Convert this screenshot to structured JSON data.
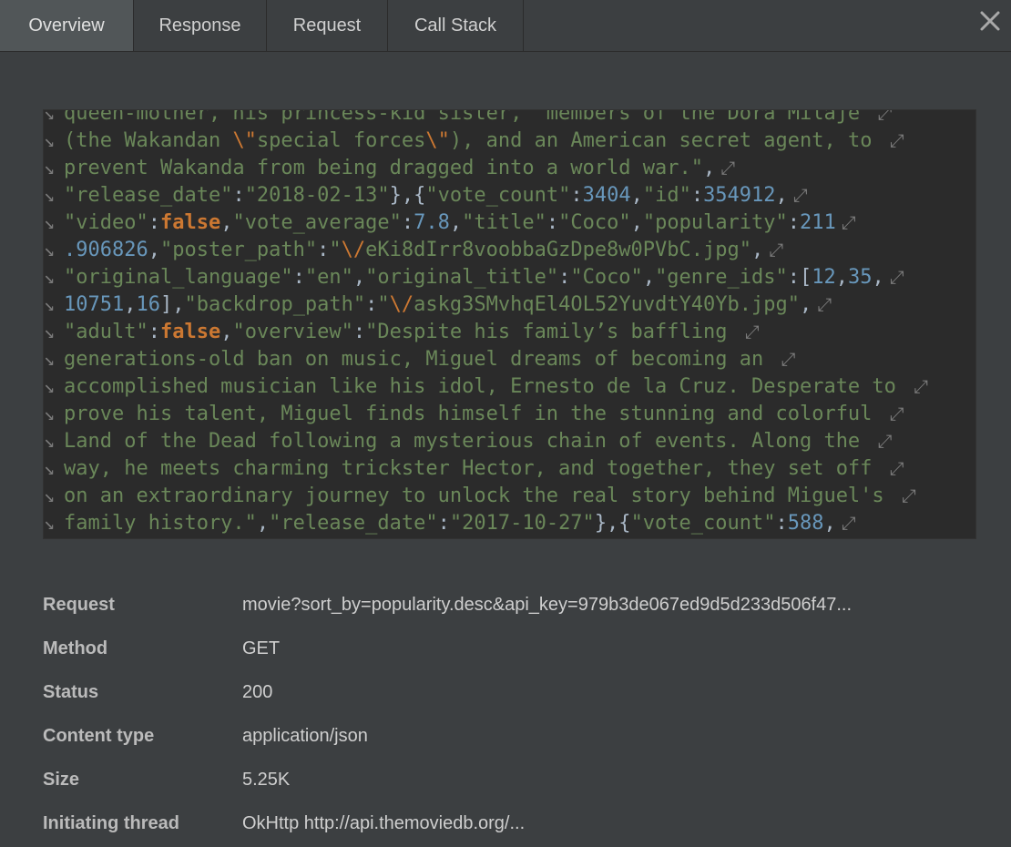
{
  "tabs": [
    {
      "label": "Overview",
      "active": true
    },
    {
      "label": "Response",
      "active": false
    },
    {
      "label": "Request",
      "active": false
    },
    {
      "label": "Call Stack",
      "active": false
    }
  ],
  "close_icon": "close-icon",
  "code": {
    "wrap_in_icon": "↘",
    "wrap_out_icon": "⤢",
    "lines": [
      [
        [
          "str",
          "queen-mother, his princess-kid sister, \"members of the Dora Milaje "
        ]
      ],
      [
        [
          "str",
          "(the Wakandan "
        ],
        [
          "esc",
          "\\\""
        ],
        [
          "str",
          "special forces"
        ],
        [
          "esc",
          "\\\""
        ],
        [
          "str",
          "), and an American secret agent, to "
        ]
      ],
      [
        [
          "str",
          "prevent Wakanda from being dragged into a world war.\""
        ],
        [
          "punc",
          ","
        ]
      ],
      [
        [
          "key",
          "\"release_date\""
        ],
        [
          "punc",
          ":"
        ],
        [
          "str",
          "\"2018-02-13\""
        ],
        [
          "punc",
          "},{"
        ],
        [
          "key",
          "\"vote_count\""
        ],
        [
          "punc",
          ":"
        ],
        [
          "num",
          "3404"
        ],
        [
          "punc",
          ","
        ],
        [
          "key",
          "\"id\""
        ],
        [
          "punc",
          ":"
        ],
        [
          "num",
          "354912"
        ],
        [
          "punc",
          ","
        ]
      ],
      [
        [
          "key",
          "\"video\""
        ],
        [
          "punc",
          ":"
        ],
        [
          "kw",
          "false"
        ],
        [
          "punc",
          ","
        ],
        [
          "key",
          "\"vote_average\""
        ],
        [
          "punc",
          ":"
        ],
        [
          "num",
          "7.8"
        ],
        [
          "punc",
          ","
        ],
        [
          "key",
          "\"title\""
        ],
        [
          "punc",
          ":"
        ],
        [
          "str",
          "\"Coco\""
        ],
        [
          "punc",
          ","
        ],
        [
          "key",
          "\"popularity\""
        ],
        [
          "punc",
          ":"
        ],
        [
          "num",
          "211"
        ]
      ],
      [
        [
          "num",
          ".906826"
        ],
        [
          "punc",
          ","
        ],
        [
          "key",
          "\"poster_path\""
        ],
        [
          "punc",
          ":"
        ],
        [
          "str",
          "\""
        ],
        [
          "esc",
          "\\/"
        ],
        [
          "str",
          "eKi8dIrr8voobbaGzDpe8w0PVbC.jpg\""
        ],
        [
          "punc",
          ","
        ]
      ],
      [
        [
          "key",
          "\"original_language\""
        ],
        [
          "punc",
          ":"
        ],
        [
          "str",
          "\"en\""
        ],
        [
          "punc",
          ","
        ],
        [
          "key",
          "\"original_title\""
        ],
        [
          "punc",
          ":"
        ],
        [
          "str",
          "\"Coco\""
        ],
        [
          "punc",
          ","
        ],
        [
          "key",
          "\"genre_ids\""
        ],
        [
          "punc",
          ":["
        ],
        [
          "num",
          "12"
        ],
        [
          "punc",
          ","
        ],
        [
          "num",
          "35"
        ],
        [
          "punc",
          ","
        ]
      ],
      [
        [
          "num",
          "10751"
        ],
        [
          "punc",
          ","
        ],
        [
          "num",
          "16"
        ],
        [
          "punc",
          "],"
        ],
        [
          "key",
          "\"backdrop_path\""
        ],
        [
          "punc",
          ":"
        ],
        [
          "str",
          "\""
        ],
        [
          "esc",
          "\\/"
        ],
        [
          "str",
          "askg3SMvhqEl4OL52YuvdtY40Yb.jpg\""
        ],
        [
          "punc",
          ","
        ]
      ],
      [
        [
          "key",
          "\"adult\""
        ],
        [
          "punc",
          ":"
        ],
        [
          "kw",
          "false"
        ],
        [
          "punc",
          ","
        ],
        [
          "key",
          "\"overview\""
        ],
        [
          "punc",
          ":"
        ],
        [
          "str",
          "\"Despite his family’s baffling "
        ]
      ],
      [
        [
          "str",
          "generations-old ban on music, Miguel dreams of becoming an "
        ]
      ],
      [
        [
          "str",
          "accomplished musician like his idol, Ernesto de la Cruz. Desperate to "
        ]
      ],
      [
        [
          "str",
          "prove his talent, Miguel finds himself in the stunning and colorful "
        ]
      ],
      [
        [
          "str",
          "Land of the Dead following a mysterious chain of events. Along the "
        ]
      ],
      [
        [
          "str",
          "way, he meets charming trickster Hector, and together, they set off "
        ]
      ],
      [
        [
          "str",
          "on an extraordinary journey to unlock the real story behind Miguel's "
        ]
      ],
      [
        [
          "str",
          "family history.\""
        ],
        [
          "punc",
          ","
        ],
        [
          "key",
          "\"release_date\""
        ],
        [
          "punc",
          ":"
        ],
        [
          "str",
          "\"2017-10-27\""
        ],
        [
          "punc",
          "},{"
        ],
        [
          "key",
          "\"vote_count\""
        ],
        [
          "punc",
          ":"
        ],
        [
          "num",
          "588"
        ],
        [
          "punc",
          ","
        ]
      ]
    ]
  },
  "properties": [
    {
      "label": "Request",
      "value": "movie?sort_by=popularity.desc&api_key=979b3de067ed9d5d233d506f47..."
    },
    {
      "label": "Method",
      "value": "GET"
    },
    {
      "label": "Status",
      "value": "200"
    },
    {
      "label": "Content type",
      "value": "application/json"
    },
    {
      "label": "Size",
      "value": "5.25K"
    },
    {
      "label": "Initiating thread",
      "value": "OkHttp http://api.themoviedb.org/..."
    }
  ]
}
